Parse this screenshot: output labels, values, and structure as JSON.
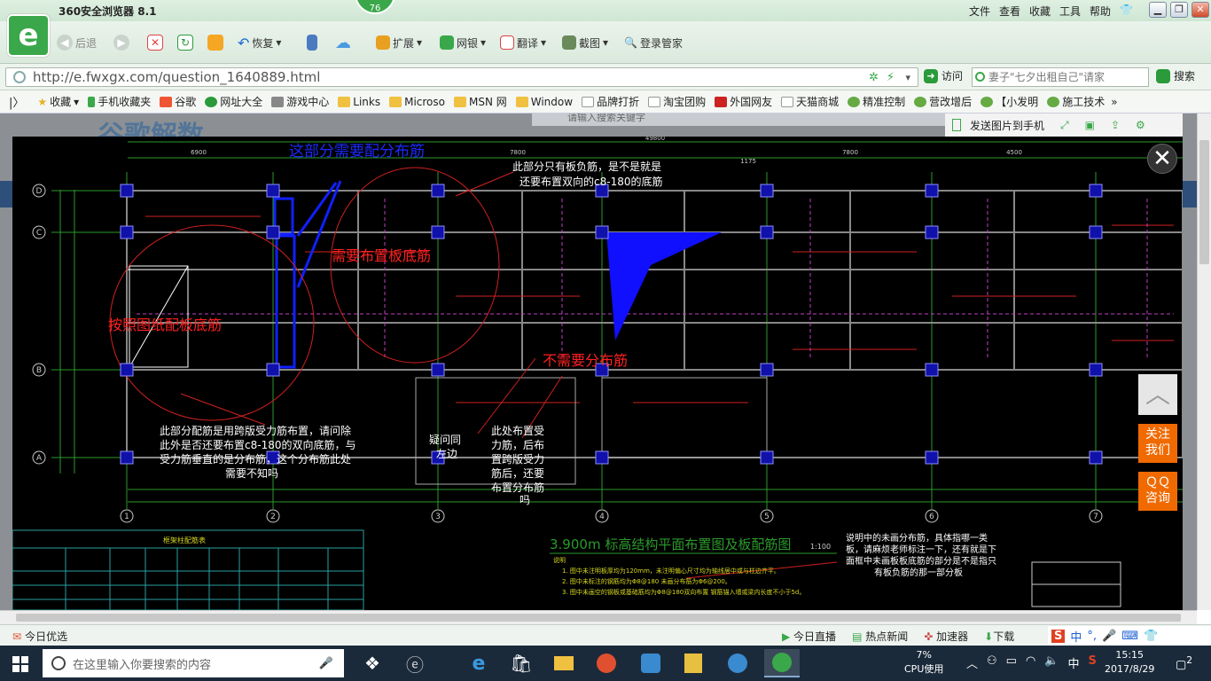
{
  "browser": {
    "title": "360安全浏览器 8.1",
    "badge": "76",
    "logo_glyph": "e",
    "menu": [
      "文件",
      "查看",
      "收藏",
      "工具",
      "帮助"
    ],
    "toolbar": {
      "back": "后退",
      "restore": "恢复",
      "extend": "扩展",
      "bank": "网银",
      "translate": "翻译",
      "screenshot": "截图",
      "login": "登录管家"
    },
    "address": {
      "url": "http://e.fwxgx.com/question_1640889.html",
      "visit": "访问",
      "search_placeholder": "妻子\"七夕出租自己\"请家",
      "search_btn": "搜索"
    },
    "favorites": [
      "收藏",
      "手机收藏夹",
      "谷歌",
      "网址大全",
      "游戏中心",
      "Links",
      "Microso",
      "MSN 网",
      "Window",
      "品牌打折",
      "淘宝团购",
      "外国网友",
      "天猫商城",
      "精准控制",
      "营改增后",
      "【小发明",
      "施工技术"
    ]
  },
  "page": {
    "header_partial": "谷歌解数",
    "search_hint": "请输入搜索关键字"
  },
  "viewer": {
    "send_to_phone": "发送图片到手机",
    "close_glyph": "✕"
  },
  "side": {
    "top": "︿",
    "follow": [
      "关注",
      "我们"
    ],
    "qq": [
      "ＱＱ",
      "咨询"
    ]
  },
  "drawing": {
    "notes_blue": "这部分需要配分布筋",
    "notes_red_1": "需要布置板底筋",
    "notes_red_2": "按照图纸配板底筋",
    "notes_red_3": "不需要分布筋",
    "q_top": [
      "此部分只有板负筋，是不是就是",
      "还要布置双向的c8-180的底筋"
    ],
    "q_left": [
      "此部分配筋是用跨版受力筋布置，请问除",
      "此外是否还要布置c8-180的双向底筋，与",
      "受力筋垂直的是分布筋，这个分布筋此处",
      "需要不知吗"
    ],
    "q_mid": [
      "疑问同",
      "左边"
    ],
    "q_right": [
      "此处布置受",
      "力筋，后布",
      "置跨版受力",
      "筋后，还要",
      "布置分布筋",
      "吗"
    ],
    "q_bottom": [
      "说明中的未画分布筋，具体指哪一类",
      "板，请麻烦老师标注一下，还有就是下",
      "面框中未画板板底筋的部分是不是指只",
      "有板负筋的那一部分板"
    ],
    "plan_title": "3.900m  标高结构平面布置图及板配筋图",
    "plan_scale": "1:100",
    "table_title": "框架柱配筋表",
    "dims_top": [
      "49800",
      "6900",
      "7800",
      "7800",
      "1175",
      "4500"
    ],
    "axis_rows": [
      "D",
      "C",
      "B",
      "A"
    ],
    "axis_cols": [
      "1",
      "2",
      "3",
      "4",
      "5",
      "6",
      "7"
    ],
    "notes_small": [
      "说明",
      "1. 图中未注明板厚均为120mm，未注明偏心尺寸均为轴线居中或与柱边齐平。",
      "2. 图中未标注的钢筋均为Φ8@180 未画分布筋为Φ6@200。",
      "3. 图中未画空的钢板或基础筋均为Φ8@180双向布置 钢筋锚入墙或梁内长度不小于5d。"
    ]
  },
  "status": {
    "left": "今日优选",
    "items": [
      "今日直播",
      "热点新闻",
      "加速器",
      "下载"
    ]
  },
  "taskbar": {
    "search_placeholder": "在这里输入你要搜索的内容",
    "cpu_pct": "7%",
    "cpu_label": "CPU使用",
    "ime": "中",
    "time": "15:15",
    "date": "2017/8/29",
    "notif": "2"
  }
}
